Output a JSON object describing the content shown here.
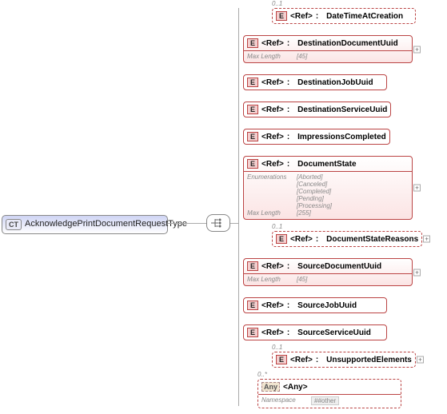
{
  "root": {
    "badge": "CT",
    "name": "AcknowledgePrintDocumentRequestType"
  },
  "items": [
    {
      "occ": "0..1",
      "indent": 36,
      "dashed": true,
      "badge": "E",
      "ref": "<Ref>",
      "name": "DateTimeAtCreation",
      "plus": false,
      "meta": null
    },
    {
      "occ": "",
      "indent": 0,
      "dashed": false,
      "badge": "E",
      "ref": "<Ref>",
      "name": "DestinationDocumentUuid",
      "plus": true,
      "meta": [
        [
          "Max Length",
          "[45]"
        ]
      ],
      "detail": true
    },
    {
      "occ": "",
      "indent": 0,
      "dashed": false,
      "badge": "E",
      "ref": "<Ref>",
      "name": "DestinationJobUuid",
      "plus": false,
      "meta": null
    },
    {
      "occ": "",
      "indent": 0,
      "dashed": false,
      "badge": "E",
      "ref": "<Ref>",
      "name": "DestinationServiceUuid",
      "plus": false,
      "meta": null
    },
    {
      "occ": "",
      "indent": 0,
      "dashed": false,
      "badge": "E",
      "ref": "<Ref>",
      "name": "ImpressionsCompleted",
      "plus": false,
      "meta": null
    },
    {
      "occ": "",
      "indent": 0,
      "dashed": false,
      "badge": "E",
      "ref": "<Ref>",
      "name": "DocumentState",
      "plus": true,
      "meta": [
        [
          "Enumerations",
          "[Aborted]"
        ],
        [
          "",
          "[Canceled]"
        ],
        [
          "",
          "[Completed]"
        ],
        [
          "",
          "[Pending]"
        ],
        [
          "",
          "[Processing]"
        ],
        [
          "Max Length",
          "[255]"
        ]
      ],
      "detail": true
    },
    {
      "occ": "0..1",
      "indent": 36,
      "dashed": true,
      "badge": "E",
      "ref": "<Ref>",
      "name": "DocumentStateReasons",
      "plus": true,
      "meta": null
    },
    {
      "occ": "",
      "indent": 0,
      "dashed": false,
      "badge": "E",
      "ref": "<Ref>",
      "name": "SourceDocumentUuid",
      "plus": true,
      "meta": [
        [
          "Max Length",
          "[45]"
        ]
      ],
      "detail": true
    },
    {
      "occ": "",
      "indent": 0,
      "dashed": false,
      "badge": "E",
      "ref": "<Ref>",
      "name": "SourceJobUuid",
      "plus": false,
      "meta": null
    },
    {
      "occ": "",
      "indent": 0,
      "dashed": false,
      "badge": "E",
      "ref": "<Ref>",
      "name": "SourceServiceUuid",
      "plus": false,
      "meta": null
    },
    {
      "occ": "0..1",
      "indent": 36,
      "dashed": true,
      "badge": "E",
      "ref": "<Ref>",
      "name": "UnsupportedElements",
      "plus": true,
      "meta": null
    },
    {
      "occ": "0..*",
      "indent": 18,
      "dashed": true,
      "badge": "Any",
      "ref": "<Any>",
      "name": "",
      "plus": false,
      "meta": [
        [
          "Namespace",
          "##other"
        ]
      ],
      "anybox": true
    }
  ]
}
